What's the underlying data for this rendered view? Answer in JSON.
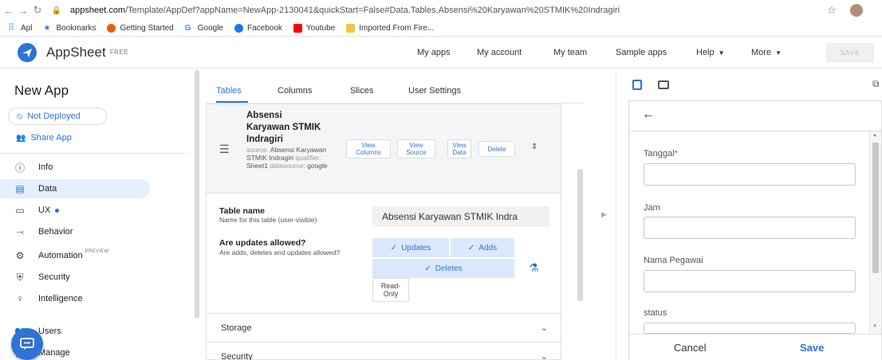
{
  "browser": {
    "url_domain": "appsheet.com",
    "url_path": "/Template/AppDef?appName=NewApp-2130041&quickStart=False#Data.Tables.Absensi%20Karyawan%20STMIK%20Indragiri",
    "bookmarks": [
      {
        "label": "Apl",
        "icon": "apps-grid-icon",
        "color": "#4285f4"
      },
      {
        "label": "Bookmarks",
        "icon": "star-icon",
        "color": "#2f73d6"
      },
      {
        "label": "Getting Started",
        "icon": "firefox-icon",
        "color": "#e66000"
      },
      {
        "label": "Google",
        "icon": "google-icon",
        "color": "#4285f4"
      },
      {
        "label": "Facebook",
        "icon": "facebook-icon",
        "color": "#1877f2"
      },
      {
        "label": "Youtube",
        "icon": "youtube-icon",
        "color": "#ff0000"
      },
      {
        "label": "Imported From Fire...",
        "icon": "folder-icon",
        "color": "#f5c242"
      }
    ]
  },
  "topbar": {
    "brand": "AppSheet",
    "tier": "FREE",
    "nav": [
      "My apps",
      "My account",
      "My team",
      "Sample apps",
      "Help",
      "More"
    ],
    "save_label": "SAVE"
  },
  "sidebar": {
    "app_name": "New App",
    "deploy_status": "Not Deployed",
    "share": "Share App",
    "items": [
      {
        "label": "Info",
        "icon": "info-icon",
        "glyph": "ⓘ"
      },
      {
        "label": "Data",
        "icon": "data-icon",
        "glyph": "▤"
      },
      {
        "label": "UX",
        "icon": "ux-icon",
        "glyph": "▭"
      },
      {
        "label": "Behavior",
        "icon": "behavior-icon",
        "glyph": "⤙"
      },
      {
        "label": "Automation",
        "icon": "automation-icon",
        "glyph": "⚙",
        "badge": "PREVIEW"
      },
      {
        "label": "Security",
        "icon": "security-icon",
        "glyph": "⛨"
      },
      {
        "label": "Intelligence",
        "icon": "intelligence-icon",
        "glyph": "♀"
      },
      {
        "label": "Users",
        "icon": "users-icon",
        "glyph": "👥"
      },
      {
        "label": "Manage",
        "icon": "manage-icon",
        "glyph": "▣"
      }
    ],
    "active_index": 1
  },
  "tabs": [
    "Tables",
    "Columns",
    "Slices",
    "User Settings"
  ],
  "table": {
    "name_lines": [
      "Absensi",
      "Karyawan STMIK",
      "Indragiri"
    ],
    "meta_source_label": "source:",
    "meta_source_value": "Absensi Karyawan STMIK Indragiri",
    "meta_qualifier_label": "qualifier:",
    "meta_qualifier_value": "Sheet1",
    "meta_datasource_label": "datasource:",
    "meta_datasource_value": "google",
    "buttons": {
      "view_columns": [
        "View",
        "Columns"
      ],
      "view_source": [
        "View",
        "Source"
      ],
      "view_data": [
        "View",
        "Data"
      ],
      "delete": "Delete"
    },
    "table_name_label": "Table name",
    "table_name_hint": "Name for this table (user-visible)",
    "table_name_value": "Absensi Karyawan STMIK Indra",
    "updates_label": "Are updates allowed?",
    "updates_hint": "Are adds, deletes and updates allowed?",
    "updates": "Updates",
    "adds": "Adds",
    "deletes": "Deletes",
    "read_only": [
      "Read-",
      "Only"
    ],
    "sections": [
      "Storage",
      "Security"
    ]
  },
  "preview": {
    "fields": [
      {
        "label": "Tanggal",
        "required": true
      },
      {
        "label": "Jam",
        "required": false
      },
      {
        "label": "Nama Pegawai",
        "required": false
      },
      {
        "label": "status",
        "required": false
      }
    ],
    "required_mark": "*",
    "cancel": "Cancel",
    "save": "Save"
  },
  "colors": {
    "accent": "#2f73d6",
    "active_bg": "#e4efff",
    "updates_bg": "#dbe8fb"
  }
}
